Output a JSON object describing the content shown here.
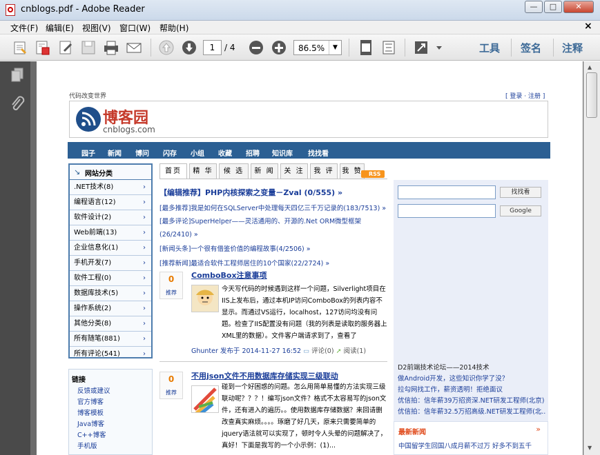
{
  "window": {
    "title": "cnblogs.pdf - Adobe Reader",
    "controls": [
      "—",
      "□",
      "✕"
    ]
  },
  "menu": [
    "文件(F)",
    "编辑(E)",
    "视图(V)",
    "窗口(W)",
    "帮助(H)"
  ],
  "menu_close": "×",
  "toolbar": {
    "page_current": "1",
    "page_total": "/ 4",
    "zoom": "86.5%",
    "tools": "工具",
    "sign": "签名",
    "comment": "注释"
  },
  "pdf": {
    "top_left": "代码改变世界",
    "top_right": "[ 登录 · 注册 ]",
    "logo_cn": "博客园",
    "logo_en": "cnblogs.com",
    "nav": [
      "园子",
      "新闻",
      "博问",
      "闪存",
      "小组",
      "收藏",
      "招聘",
      "知识库",
      "找找看"
    ],
    "cat_title": "网站分类",
    "categories": [
      ".NET技术(8)",
      "编程语言(12)",
      "软件设计(2)",
      "Web前端(13)",
      "企业信息化(1)",
      "手机开发(7)",
      "软件工程(0)",
      "数据库技术(5)",
      "操作系统(2)",
      "其他分类(8)",
      "所有随笔(881)",
      "所有评论(541)"
    ],
    "links_title": "链接",
    "links": [
      "反馈或建议",
      "官方博客",
      "博客模板",
      "Java博客",
      "C++博客",
      "手机版"
    ],
    "tabs": [
      "首页",
      "精 华",
      "候 选",
      "新 闻",
      "关 注",
      "我 评",
      "我 赞"
    ],
    "rss": "RSS",
    "headline": "【编辑推荐】PHP内核探索之变量－Zval (0/555) »",
    "news": [
      "[最多推荐]我是如何在SQLServer中处理每天四亿三千万记录的(183/7513) »",
      "[最多评论]SuperHelper——灵活通用的、开源的.Net ORM微型框架(26/2410) »",
      "[新闻头条]一个很有借鉴价值的编程故事(4/2506) »",
      "[推荐新闻]最适合软件工程师居住的10个国家(22/2724) »"
    ],
    "posts": [
      {
        "votes": "0",
        "digg": "推荐",
        "title": "ComboBox注意事项",
        "body": "今天写代码的时候遇到这样一个问题，Silverlight项目在IIS上发布后，通过本机IP访问ComboBox的列表内容不显示。而通过VS运行，localhost，127访问均没有问题。检查了IIS配置没有问题（我的列表是读取的服务器上XML里的数据）。文件客户端请求到了，查看了DisplayMem...",
        "meta": "Ghunter 发布于 2014-11-27 16:52",
        "comments": "评论(0)",
        "reads": "阅读(1)"
      },
      {
        "votes": "0",
        "digg": "推荐",
        "title": "不用json文件不用数据库存储实现三级联动",
        "body": "碰到一个好困惑的问题。怎么用简单易懂的方法实现三级联动呢？？？！编写json文件？格式不太容易写的json文件，还有进入的遍历。。使用数据库存储数据？来回请删改查真实麻烦。。。。琢磨了好几天，原来只需要简单的jquery语法就可以实现了，顿时令人头晕的问题解决了，真好！下面是我写的一个小示例：(1)..."
      }
    ],
    "search_button": "找找看",
    "google_button": "Google",
    "right_links": [
      "D2前端技术论坛——2014技术",
      "做Android开发，这些知识你学了没？",
      "拉勾网找工作，薪资透明！拒绝面议",
      "优信拍：信年薪39万招资深.NET研发工程师(北京)",
      "优信拍：信年薪32.5万招高级.NET研发工程师(北..."
    ],
    "latest_title": "最新新闻",
    "latest_more": "»",
    "latest_first": "中国留学生回国八成月薪不过万 好多不到五千"
  }
}
